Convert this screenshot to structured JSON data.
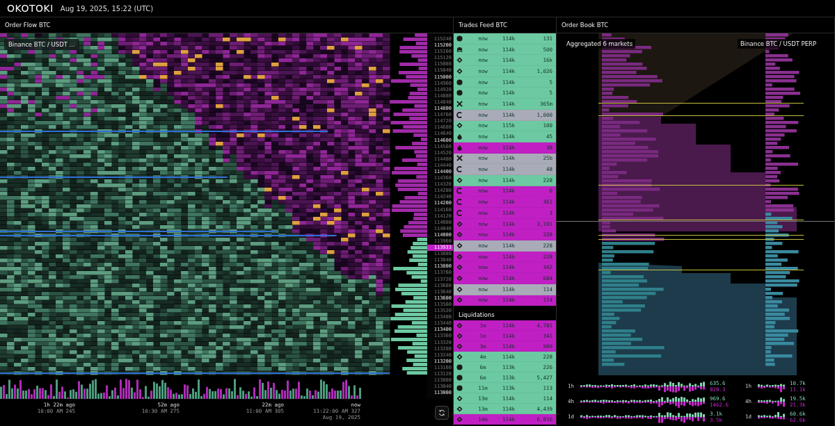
{
  "header": {
    "logo": "OKOTOKI",
    "datetime": "Aug 19, 2025, 15:22 (UTC)"
  },
  "order_flow": {
    "title": "Order Flow BTC",
    "market": "Binance BTC / USDT ...",
    "price_axis": [
      {
        "kind": "minor",
        "text": "115240"
      },
      {
        "kind": "major",
        "text": "115200"
      },
      {
        "kind": "minor",
        "text": "115160"
      },
      {
        "kind": "minor",
        "text": "115120"
      },
      {
        "kind": "minor",
        "text": "115080"
      },
      {
        "kind": "minor",
        "text": "115040"
      },
      {
        "kind": "major",
        "text": "115000"
      },
      {
        "kind": "minor",
        "text": "114960"
      },
      {
        "kind": "minor",
        "text": "114920"
      },
      {
        "kind": "minor",
        "text": "114880"
      },
      {
        "kind": "minor",
        "text": "114840"
      },
      {
        "kind": "major",
        "text": "114800"
      },
      {
        "kind": "minor",
        "text": "114760"
      },
      {
        "kind": "minor",
        "text": "114720"
      },
      {
        "kind": "minor",
        "text": "114680"
      },
      {
        "kind": "minor",
        "text": "114640"
      },
      {
        "kind": "major",
        "text": "114600"
      },
      {
        "kind": "minor",
        "text": "114560"
      },
      {
        "kind": "minor",
        "text": "114520"
      },
      {
        "kind": "minor",
        "text": "114480"
      },
      {
        "kind": "minor",
        "text": "114440"
      },
      {
        "kind": "major",
        "text": "114400"
      },
      {
        "kind": "minor",
        "text": "114360"
      },
      {
        "kind": "minor",
        "text": "114320"
      },
      {
        "kind": "minor",
        "text": "114280"
      },
      {
        "kind": "minor",
        "text": "114240"
      },
      {
        "kind": "major",
        "text": "114200"
      },
      {
        "kind": "minor",
        "text": "114160"
      },
      {
        "kind": "minor",
        "text": "114120"
      },
      {
        "kind": "minor",
        "text": "114080"
      },
      {
        "kind": "minor",
        "text": "114040"
      },
      {
        "kind": "major",
        "text": "114000"
      },
      {
        "kind": "minor",
        "text": "113960"
      },
      {
        "kind": "current",
        "text": "113933"
      },
      {
        "kind": "minor",
        "text": "113880"
      },
      {
        "kind": "minor",
        "text": "113840"
      },
      {
        "kind": "major",
        "text": "113800"
      },
      {
        "kind": "minor",
        "text": "113760"
      },
      {
        "kind": "minor",
        "text": "113720"
      },
      {
        "kind": "minor",
        "text": "113680"
      },
      {
        "kind": "minor",
        "text": "113640"
      },
      {
        "kind": "major",
        "text": "113600"
      },
      {
        "kind": "minor",
        "text": "113560"
      },
      {
        "kind": "minor",
        "text": "113520"
      },
      {
        "kind": "minor",
        "text": "113480"
      },
      {
        "kind": "minor",
        "text": "113440"
      },
      {
        "kind": "major",
        "text": "113400"
      },
      {
        "kind": "minor",
        "text": "113360"
      },
      {
        "kind": "minor",
        "text": "113320"
      },
      {
        "kind": "minor",
        "text": "113280"
      },
      {
        "kind": "minor",
        "text": "113240"
      },
      {
        "kind": "major",
        "text": "113200"
      },
      {
        "kind": "minor",
        "text": "113160"
      },
      {
        "kind": "minor",
        "text": "113120"
      },
      {
        "kind": "minor",
        "text": "113080"
      },
      {
        "kind": "minor",
        "text": "113040"
      },
      {
        "kind": "major",
        "text": "113000"
      }
    ],
    "time_axis": [
      {
        "relative": "1h 22m ago",
        "time": "10:00 AM 245"
      },
      {
        "relative": "52m ago",
        "time": "10:30 AM 275"
      },
      {
        "relative": "22m ago",
        "time": "11:00 AM 305"
      },
      {
        "relative": "now",
        "time": "11:22:00 AM 327",
        "date": "Aug 19, 2025"
      }
    ]
  },
  "trades_feed": {
    "title": "Trades Feed BTC",
    "rows": [
      {
        "kind": "coin",
        "time": "now",
        "price": "114k",
        "size": "131",
        "color": "#6cc9a1"
      },
      {
        "kind": "arch",
        "time": "now",
        "price": "114k",
        "size": "500",
        "color": "#6cc9a1"
      },
      {
        "kind": "diamond",
        "time": "now",
        "price": "114k",
        "size": "16k",
        "color": "#6cc9a1"
      },
      {
        "kind": "diamond",
        "time": "now",
        "price": "114k",
        "size": "1,026",
        "color": "#6cc9a1"
      },
      {
        "kind": "coin",
        "time": "now",
        "price": "114k",
        "size": "5",
        "color": "#6cc9a1"
      },
      {
        "kind": "coin",
        "time": "now",
        "price": "114k",
        "size": "5",
        "color": "#6cc9a1"
      },
      {
        "kind": "cross",
        "time": "now",
        "price": "114k",
        "size": "365m",
        "color": "#6cc9a1"
      },
      {
        "kind": "crescent",
        "time": "now",
        "price": "114k",
        "size": "1,000",
        "color": "#a9abb8"
      },
      {
        "kind": "diamond",
        "time": "now",
        "price": "115k",
        "size": "100",
        "color": "#6cc9a1"
      },
      {
        "kind": "flame",
        "time": "now",
        "price": "114k",
        "size": "45",
        "color": "#6cc9a1"
      },
      {
        "kind": "flame",
        "time": "now",
        "price": "114k",
        "size": "38",
        "color": "#c01fc4"
      },
      {
        "kind": "cross",
        "time": "now",
        "price": "114k",
        "size": "25b",
        "color": "#a9abb8"
      },
      {
        "kind": "crescent",
        "time": "now",
        "price": "114k",
        "size": "48",
        "color": "#a9abb8"
      },
      {
        "kind": "diamond",
        "time": "now",
        "price": "114k",
        "size": "228",
        "color": "#6cc9a1"
      },
      {
        "kind": "crescent",
        "time": "now",
        "price": "114k",
        "size": "0",
        "color": "#c01fc4"
      },
      {
        "kind": "crescent",
        "time": "now",
        "price": "114k",
        "size": "361",
        "color": "#c01fc4"
      },
      {
        "kind": "crescent",
        "time": "now",
        "price": "114k",
        "size": "3",
        "color": "#c01fc4"
      },
      {
        "kind": "diamond",
        "time": "now",
        "price": "114k",
        "size": "3,191",
        "color": "#c01fc4"
      },
      {
        "kind": "diamond",
        "time": "now",
        "price": "114k",
        "size": "228",
        "color": "#c01fc4"
      },
      {
        "kind": "diamond",
        "time": "now",
        "price": "114k",
        "size": "228",
        "color": "#a9abb8"
      },
      {
        "kind": "diamond",
        "time": "now",
        "price": "114k",
        "size": "228",
        "color": "#c01fc4"
      },
      {
        "kind": "diamond",
        "time": "now",
        "price": "114k",
        "size": "342",
        "color": "#c01fc4"
      },
      {
        "kind": "diamond",
        "time": "now",
        "price": "114k",
        "size": "684",
        "color": "#c01fc4"
      },
      {
        "kind": "diamond",
        "time": "now",
        "price": "114k",
        "size": "114",
        "color": "#a9abb8"
      },
      {
        "kind": "diamond",
        "time": "now",
        "price": "114k",
        "size": "114",
        "color": "#c01fc4"
      }
    ]
  },
  "liquidations": {
    "title": "Liquidations",
    "rows": [
      {
        "kind": "diamond",
        "time": "1m",
        "price": "114k",
        "size": "4,781",
        "color": "#c01fc4"
      },
      {
        "kind": "diamond",
        "time": "1m",
        "price": "114k",
        "size": "341",
        "color": "#c01fc4"
      },
      {
        "kind": "diamond",
        "time": "3m",
        "price": "114k",
        "size": "909",
        "color": "#c01fc4"
      },
      {
        "kind": "diamond",
        "time": "4m",
        "price": "114k",
        "size": "228",
        "color": "#6cc9a1"
      },
      {
        "kind": "coin",
        "time": "6m",
        "price": "113k",
        "size": "226",
        "color": "#6cc9a1"
      },
      {
        "kind": "coin",
        "time": "6m",
        "price": "113k",
        "size": "5,427",
        "color": "#6cc9a1"
      },
      {
        "kind": "coin",
        "time": "11m",
        "price": "113k",
        "size": "113",
        "color": "#6cc9a1"
      },
      {
        "kind": "diamond",
        "time": "13m",
        "price": "114k",
        "size": "114",
        "color": "#6cc9a1"
      },
      {
        "kind": "diamond",
        "time": "13m",
        "price": "114k",
        "size": "4,439",
        "color": "#6cc9a1"
      },
      {
        "kind": "diamond",
        "time": "14m",
        "price": "114k",
        "size": "6,816",
        "color": "#c01fc4"
      }
    ]
  },
  "order_book": {
    "title": "Order Book BTC",
    "left_label": "Aggregated 6 markets",
    "right_label": "Binance BTC / USDT  PERP",
    "stats_left": [
      {
        "period": "1h",
        "buy": "635.6",
        "sell": "828.3"
      },
      {
        "period": "4h",
        "buy": "969.6",
        "sell": "1462.6"
      },
      {
        "period": "1d",
        "buy": "3.1k",
        "sell": "3.5k"
      }
    ],
    "stats_right": [
      {
        "period": "1h",
        "buy": "10.7k",
        "sell": "11.1k"
      },
      {
        "period": "4h",
        "buy": "19.5k",
        "sell": "21.3k"
      },
      {
        "period": "1d",
        "buy": "60.6k",
        "sell": "62.6k"
      }
    ]
  }
}
